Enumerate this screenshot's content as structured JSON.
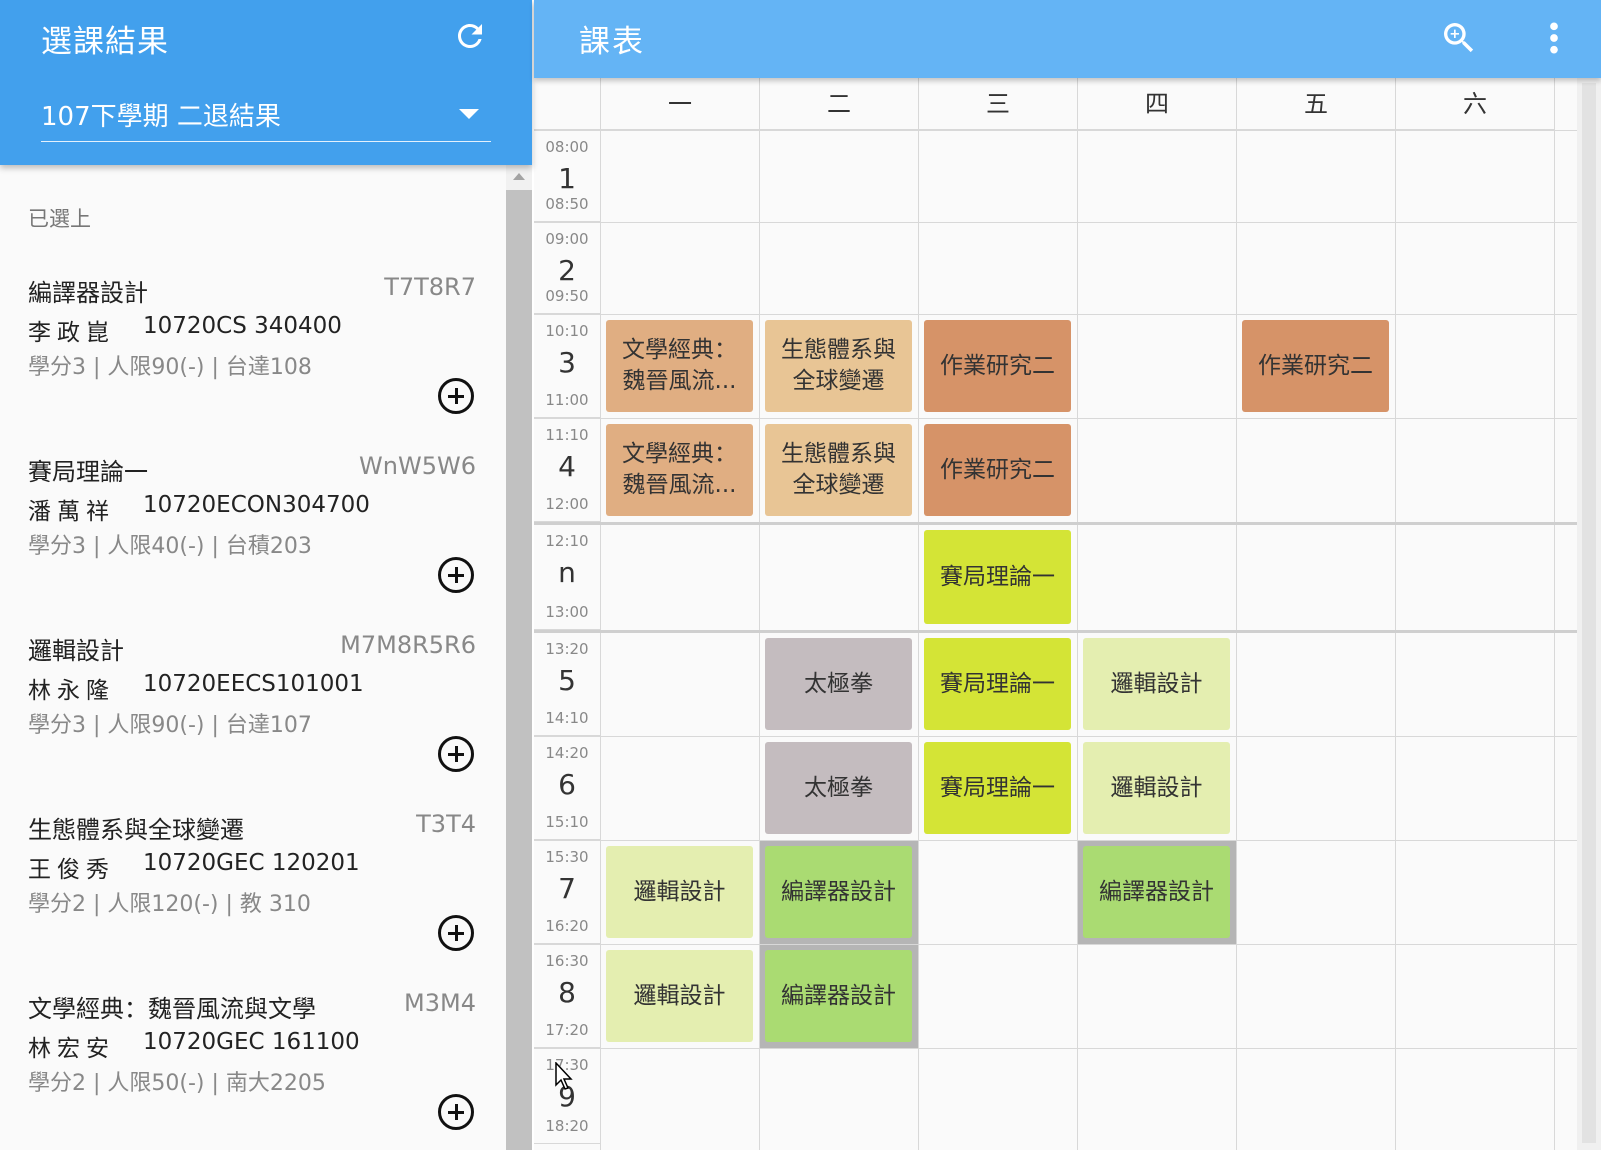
{
  "left_panel": {
    "title": "選課結果",
    "semester_select": {
      "value": "107下學期 二退結果"
    },
    "section_label": "已選上",
    "courses": [
      {
        "name": "編譯器設計",
        "time": "T7T8R7",
        "teacher": "李政崑",
        "code": "10720CS 340400",
        "info": "學分3 | 人限90(-) | 台達108"
      },
      {
        "name": "賽局理論一",
        "time": "WnW5W6",
        "teacher": "潘萬祥",
        "code": "10720ECON304700",
        "info": "學分3 | 人限40(-) | 台積203"
      },
      {
        "name": "邏輯設計",
        "time": "M7M8R5R6",
        "teacher": "林永隆",
        "code": "10720EECS101001",
        "info": "學分3 | 人限90(-) | 台達107"
      },
      {
        "name": "生態體系與全球變遷",
        "time": "T3T4",
        "teacher": "王俊秀",
        "code": "10720GEC 120201",
        "info": "學分2 | 人限120(-) | 教 310"
      },
      {
        "name": "文學經典：魏晉風流與文學",
        "time": "M3M4",
        "teacher": "林宏安",
        "code": "10720GEC 161100",
        "info": "學分2 | 人限50(-) | 南大2205"
      }
    ]
  },
  "right_panel": {
    "title": "課表",
    "days": [
      "一",
      "二",
      "三",
      "四",
      "五",
      "六"
    ],
    "periods": [
      {
        "num": "1",
        "start": "08:00",
        "end": "08:50"
      },
      {
        "num": "2",
        "start": "09:00",
        "end": "09:50"
      },
      {
        "num": "3",
        "start": "10:10",
        "end": "11:00"
      },
      {
        "num": "4",
        "start": "11:10",
        "end": "12:00"
      },
      {
        "num": "n",
        "start": "12:10",
        "end": "13:00"
      },
      {
        "num": "5",
        "start": "13:20",
        "end": "14:10"
      },
      {
        "num": "6",
        "start": "14:20",
        "end": "15:10"
      },
      {
        "num": "7",
        "start": "15:30",
        "end": "16:20"
      },
      {
        "num": "8",
        "start": "16:30",
        "end": "17:20"
      },
      {
        "num": "9",
        "start": "17:30",
        "end": "18:20"
      }
    ],
    "blocks": [
      {
        "label": "文學經典：魏晉風流...",
        "day": 0,
        "period": 2,
        "color": "#e0ae82"
      },
      {
        "label": "生態體系與全球變遷",
        "day": 1,
        "period": 2,
        "color": "#e8c595"
      },
      {
        "label": "作業研究二",
        "day": 2,
        "period": 2,
        "color": "#d69368"
      },
      {
        "label": "作業研究二",
        "day": 4,
        "period": 2,
        "color": "#d69368"
      },
      {
        "label": "文學經典：魏晉風流...",
        "day": 0,
        "period": 3,
        "color": "#e0ae82"
      },
      {
        "label": "生態體系與全球變遷",
        "day": 1,
        "period": 3,
        "color": "#e8c595"
      },
      {
        "label": "作業研究二",
        "day": 2,
        "period": 3,
        "color": "#d69368"
      },
      {
        "label": "賽局理論一",
        "day": 2,
        "period": 4,
        "color": "#d4e436"
      },
      {
        "label": "太極拳",
        "day": 1,
        "period": 5,
        "color": "#c4bcbf"
      },
      {
        "label": "賽局理論一",
        "day": 2,
        "period": 5,
        "color": "#d4e436"
      },
      {
        "label": "邏輯設計",
        "day": 3,
        "period": 5,
        "color": "#e4eeb0"
      },
      {
        "label": "太極拳",
        "day": 1,
        "period": 6,
        "color": "#c4bcbf"
      },
      {
        "label": "賽局理論一",
        "day": 2,
        "period": 6,
        "color": "#d4e436"
      },
      {
        "label": "邏輯設計",
        "day": 3,
        "period": 6,
        "color": "#e4eeb0"
      },
      {
        "label": "邏輯設計",
        "day": 0,
        "period": 7,
        "color": "#e4eeb0"
      },
      {
        "label": "編譯器設計",
        "day": 1,
        "period": 7,
        "color": "#aadb72"
      },
      {
        "label": "編譯器設計",
        "day": 3,
        "period": 7,
        "color": "#aadb72"
      },
      {
        "label": "邏輯設計",
        "day": 0,
        "period": 8,
        "color": "#e4eeb0"
      },
      {
        "label": "編譯器設計",
        "day": 1,
        "period": 8,
        "color": "#aadb72"
      }
    ]
  },
  "icons": {
    "refresh": "refresh-icon",
    "zoom": "zoom-in-icon",
    "more": "more-vert-icon",
    "add": "add-circle-icon",
    "cursor": "mouse-cursor-icon"
  },
  "colors": {
    "left_header": "#42a0ed",
    "right_header": "#64b4f5"
  }
}
